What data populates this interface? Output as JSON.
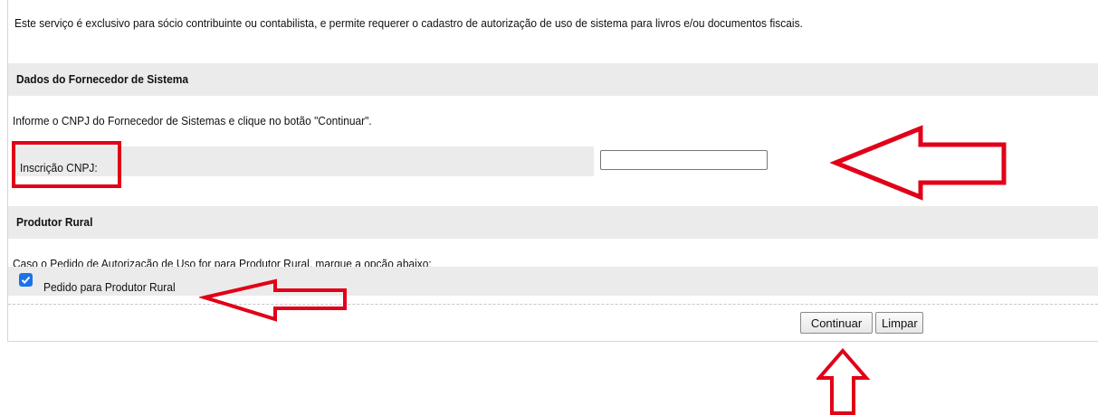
{
  "intro_text": "Este serviço é exclusivo para sócio contribuinte ou contabilista, e permite requerer o cadastro de autorização de uso de sistema para livros e/ou documentos fiscais.",
  "fornecedor": {
    "header": "Dados do Fornecedor de Sistema",
    "instruction": "Informe o CNPJ do Fornecedor de Sistemas e clique no botão \"Continuar\".",
    "cnpj_label": "Inscrição CNPJ:",
    "cnpj_value": ""
  },
  "produtor": {
    "header": "Produtor Rural",
    "instruction": "Caso o Pedido de Autorização de Uso for para Produtor Rural, marque a opção abaixo:",
    "checkbox_label": "Pedido para Produtor Rural",
    "checked": true
  },
  "buttons": {
    "continuar": "Continuar",
    "limpar": "Limpar"
  },
  "colors": {
    "annotation_red": "#e10018",
    "checkbox_blue": "#1a73e8",
    "section_gray": "#ebebeb"
  }
}
